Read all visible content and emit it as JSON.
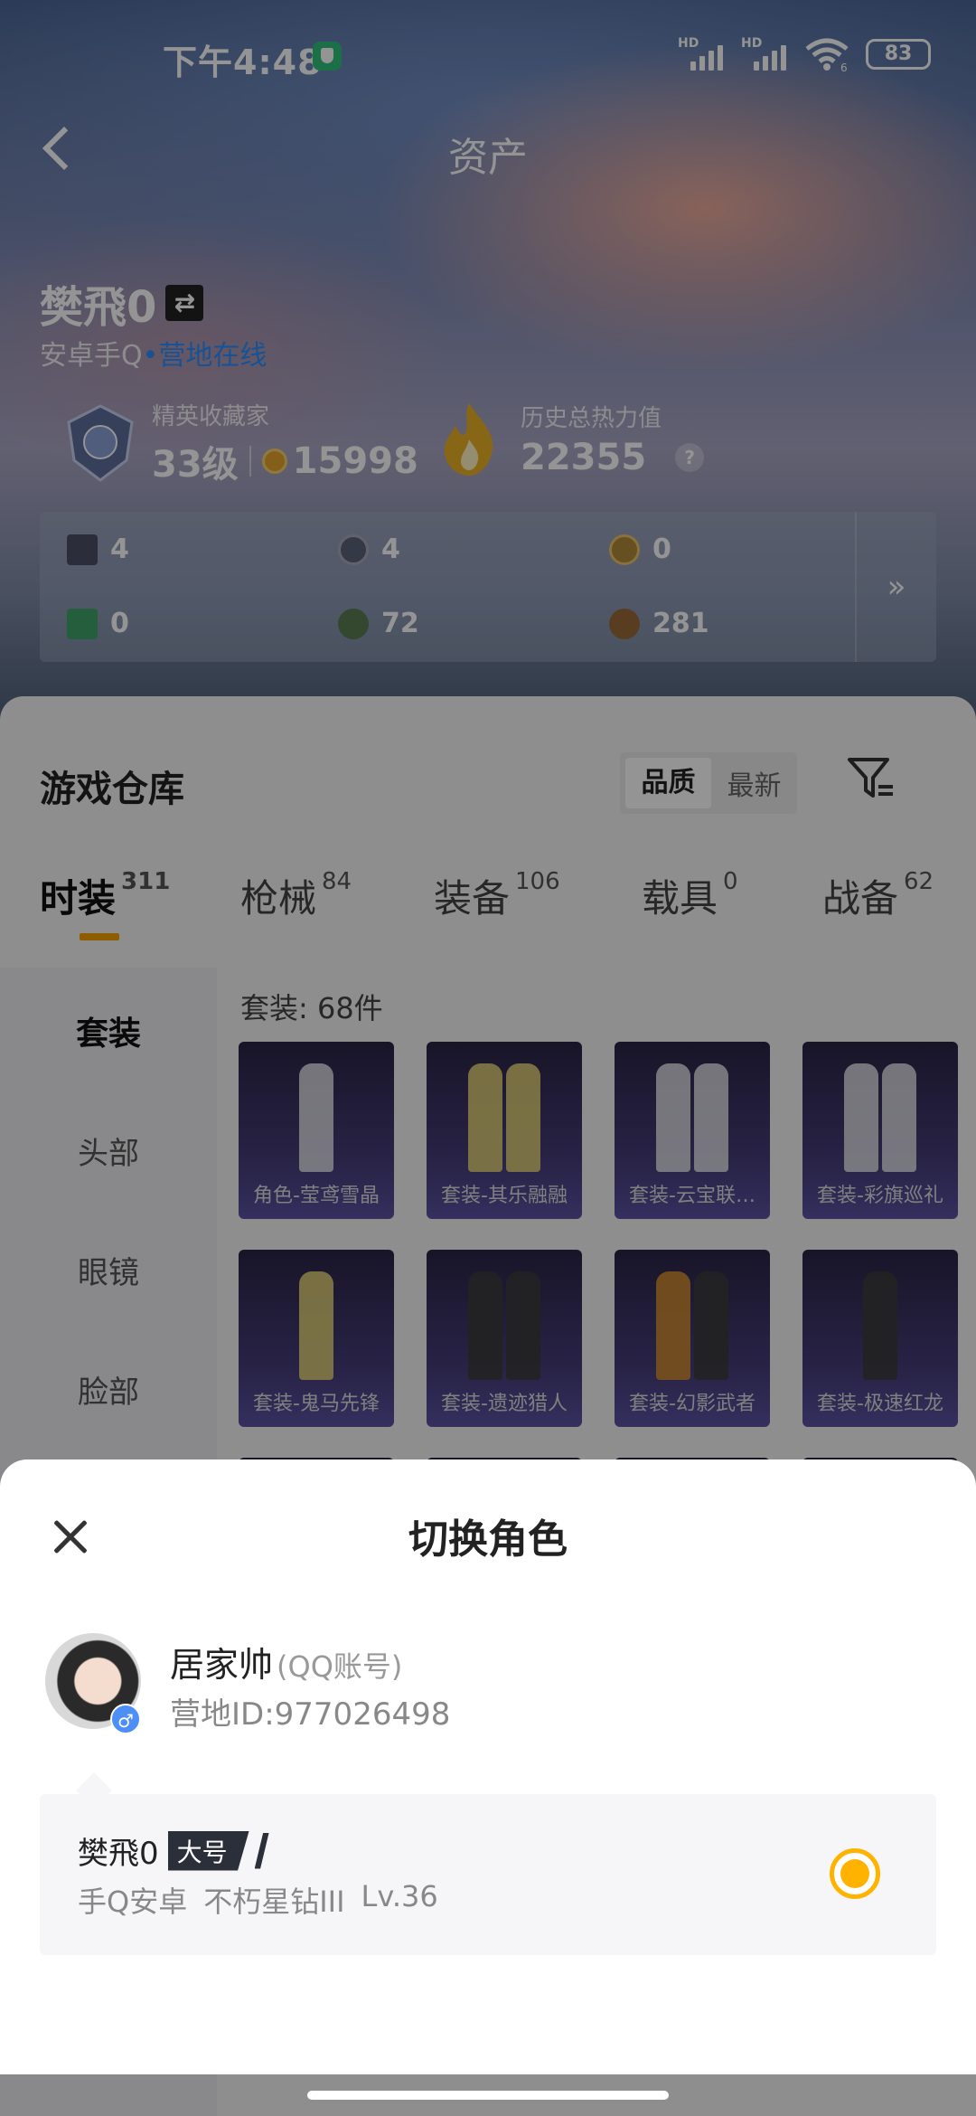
{
  "status_bar": {
    "time": "下午4:48",
    "signal_1": "HD",
    "signal_2": "HD",
    "wifi_suffix": "6",
    "battery": "83"
  },
  "nav": {
    "title": "资产",
    "back_icon": "chevron-left-icon"
  },
  "player": {
    "name": "樊飛0",
    "platform": "安卓手Q",
    "dot": "•",
    "online_status": "营地在线",
    "collector_label": "精英收藏家",
    "collector_level": "33级",
    "collector_points": "15998",
    "heat_label": "历史总热力值",
    "heat_value": "22355",
    "help_mark": "?"
  },
  "resources": [
    {
      "icon": "card-icon",
      "value": "4"
    },
    {
      "icon": "badge-icon",
      "value": "4"
    },
    {
      "icon": "emblem-icon",
      "value": "0"
    },
    {
      "icon": "ticket-icon",
      "value": "0"
    },
    {
      "icon": "orb-icon",
      "value": "72"
    },
    {
      "icon": "coin-icon",
      "value": "281"
    }
  ],
  "resources_more": "»",
  "warehouse": {
    "title": "游戏仓库",
    "sort_quality": "品质",
    "sort_newest": "最新",
    "tabs": [
      {
        "label": "时装",
        "count": "311"
      },
      {
        "label": "枪械",
        "count": "84"
      },
      {
        "label": "装备",
        "count": "106"
      },
      {
        "label": "载具",
        "count": "0"
      },
      {
        "label": "战备",
        "count": "62"
      }
    ],
    "side_nav": [
      "套装",
      "头部",
      "眼镜",
      "脸部"
    ],
    "count_label": "套装: 68件",
    "items": [
      "角色-莹鸢雪晶",
      "套装-其乐融融",
      "套装-云宝联…",
      "套装-彩旗巡礼",
      "套装-鬼马先锋",
      "套装-遗迹猎人",
      "套装-幻影武者",
      "套装-极速红龙"
    ]
  },
  "sheet": {
    "title": "切换角色",
    "account_name": "居家帅",
    "account_tag": "(QQ账号)",
    "camp_id": "营地ID:977026498",
    "gender": "♂",
    "role": {
      "name": "樊飛0",
      "badge": "大号",
      "platform": "手Q安卓",
      "rank": "不朽星钻III",
      "level": "Lv.36",
      "selected": true
    }
  }
}
